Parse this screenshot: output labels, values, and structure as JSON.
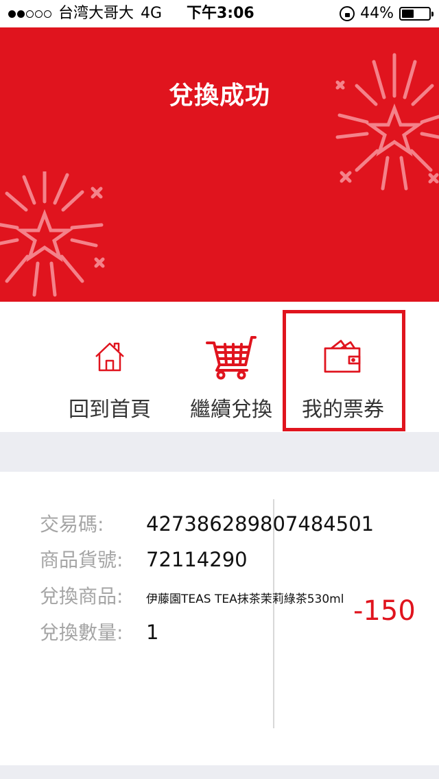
{
  "status_bar": {
    "carrier": "台湾大哥大",
    "network": "4G",
    "time": "下午3:06",
    "battery": "44%",
    "battery_level": 0.44
  },
  "header": {
    "title": "兌換成功"
  },
  "actions": [
    {
      "label": "回到首頁",
      "icon": "home-icon"
    },
    {
      "label": "繼續兌換",
      "icon": "cart-icon"
    },
    {
      "label": "我的票券",
      "icon": "wallet-icon"
    }
  ],
  "details": {
    "transaction_label": "交易碼:",
    "transaction_value": "427386289807484501",
    "sku_label": "商品貨號:",
    "sku_value": "72114290",
    "product_label": "兌換商品:",
    "product_value": "伊藤園TEAS TEA抹茶茉莉綠茶530ml",
    "qty_label": "兌換數量:",
    "qty_value": "1",
    "points": "-150"
  },
  "colors": {
    "accent": "#e0141e",
    "background": "#ecedf2"
  }
}
